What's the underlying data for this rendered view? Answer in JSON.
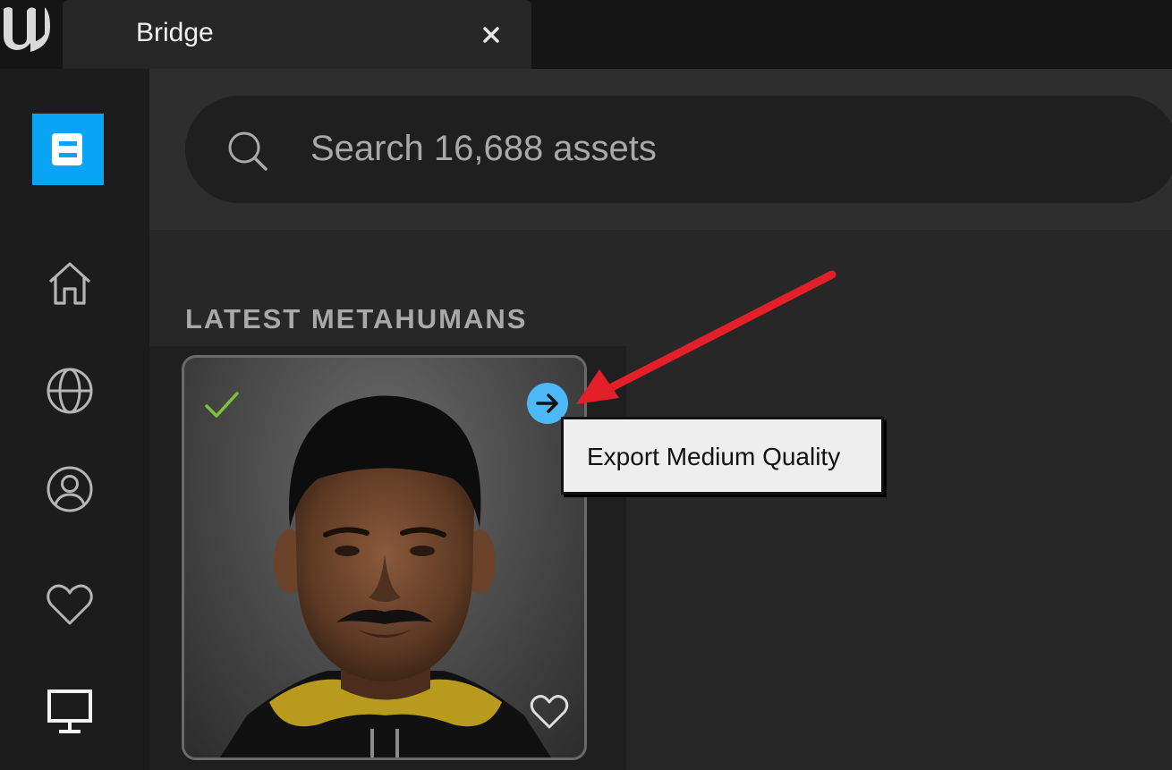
{
  "app": {
    "logo_icon": "unreal-engine-logo-icon"
  },
  "tab": {
    "title": "Bridge",
    "close_icon": "close-icon"
  },
  "sidebar": {
    "logo_icon": "bridge-logo-icon",
    "accent": "#0aa4f7",
    "items": [
      {
        "icon": "home-icon"
      },
      {
        "icon": "globe-icon"
      },
      {
        "icon": "user-icon"
      },
      {
        "icon": "heart-icon"
      },
      {
        "icon": "monitor-icon",
        "active": true
      }
    ]
  },
  "search": {
    "placeholder": "Search 16,688 assets",
    "value": "",
    "icon": "search-icon"
  },
  "section": {
    "title": "LATEST METAHUMANS"
  },
  "card": {
    "downloaded_icon": "checkmark-icon",
    "favorite_icon": "heart-icon",
    "check_color": "#7ec13a",
    "export_icon": "arrow-right-icon",
    "export_color": "#4cb8f6"
  },
  "tooltip": {
    "text": "Export Medium Quality"
  },
  "annotation": {
    "arrow_color": "#e3202a"
  }
}
